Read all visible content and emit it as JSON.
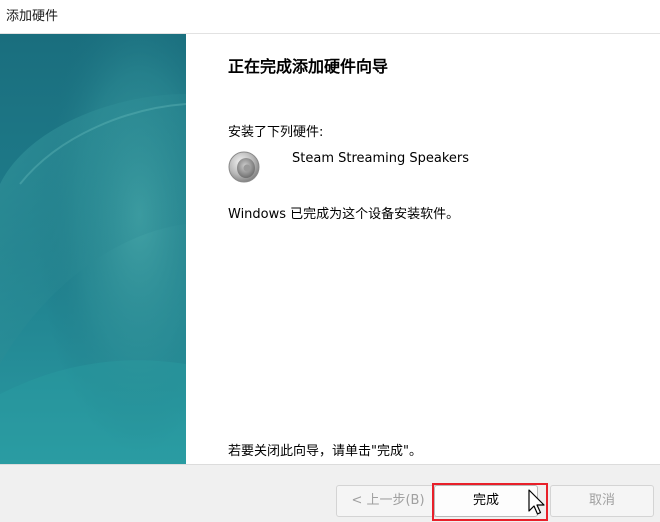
{
  "window": {
    "title": "添加硬件"
  },
  "wizard": {
    "heading": "正在完成添加硬件向导",
    "installed_label": "安装了下列硬件:",
    "device": {
      "name": "Steam Streaming Speakers",
      "icon": "speaker-icon"
    },
    "done_text": "Windows 已完成为这个设备安装软件。",
    "close_hint": "若要关闭此向导，请单击\"完成\"。"
  },
  "buttons": {
    "back_label": "< 上一步(B)",
    "finish_label": "完成",
    "cancel_label": "取消"
  },
  "colors": {
    "side_panel_teal": "#1d7c8a",
    "highlight_red": "#e8202a"
  }
}
